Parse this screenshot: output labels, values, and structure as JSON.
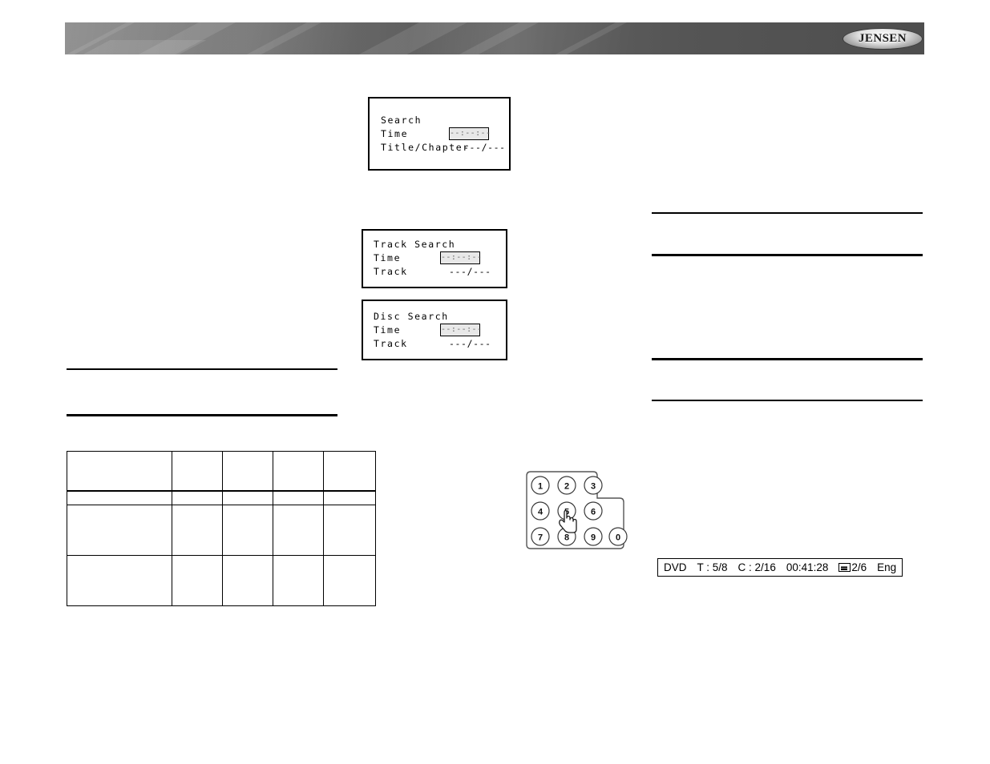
{
  "header": {
    "brand_logo_text": "JENSEN",
    "banner_color_light": "#8c8c8c",
    "banner_color_dark": "#4e4e4e"
  },
  "osd_dialogs": [
    {
      "id": "search",
      "title": "Search",
      "rows": [
        {
          "label": "Time",
          "value": "--:--:--",
          "field": true
        },
        {
          "label": "Title/Chapter",
          "value": "---/---",
          "field": false
        }
      ]
    },
    {
      "id": "track_search",
      "title": "Track Search",
      "rows": [
        {
          "label": "Time",
          "value": "--:--:--",
          "field": true
        },
        {
          "label": "Track",
          "value": "---/---",
          "field": false
        }
      ]
    },
    {
      "id": "disc_search",
      "title": "Disc Search",
      "rows": [
        {
          "label": "Time",
          "value": "--:--:--",
          "field": true
        },
        {
          "label": "Track",
          "value": "---/---",
          "field": false
        }
      ]
    }
  ],
  "keypad": {
    "keys": [
      "1",
      "2",
      "3",
      "4",
      "5",
      "6",
      "7",
      "8",
      "9",
      "0"
    ],
    "cursor_on_key": "5",
    "cursor_icon": "pointing-hand-cursor"
  },
  "status_bar": {
    "segments": [
      {
        "name": "disc-type",
        "text": "DVD"
      },
      {
        "name": "title-counter",
        "text": "T : 5/8"
      },
      {
        "name": "chapter-counter",
        "text": "C : 2/16"
      },
      {
        "name": "elapsed-time",
        "text": "00:41:28"
      },
      {
        "name": "subtitle-counter",
        "text": "2/6",
        "icon": "subtitle-icon"
      },
      {
        "name": "audio-language",
        "text": "Eng"
      }
    ]
  },
  "spec_table": {
    "columns": [
      "",
      "",
      "",
      "",
      ""
    ],
    "rows": [
      [
        "",
        "",
        "",
        "",
        ""
      ],
      [
        "",
        "",
        "",
        "",
        ""
      ],
      [
        "",
        "",
        "",
        "",
        ""
      ],
      [
        "",
        "",
        "",
        "",
        ""
      ]
    ]
  }
}
